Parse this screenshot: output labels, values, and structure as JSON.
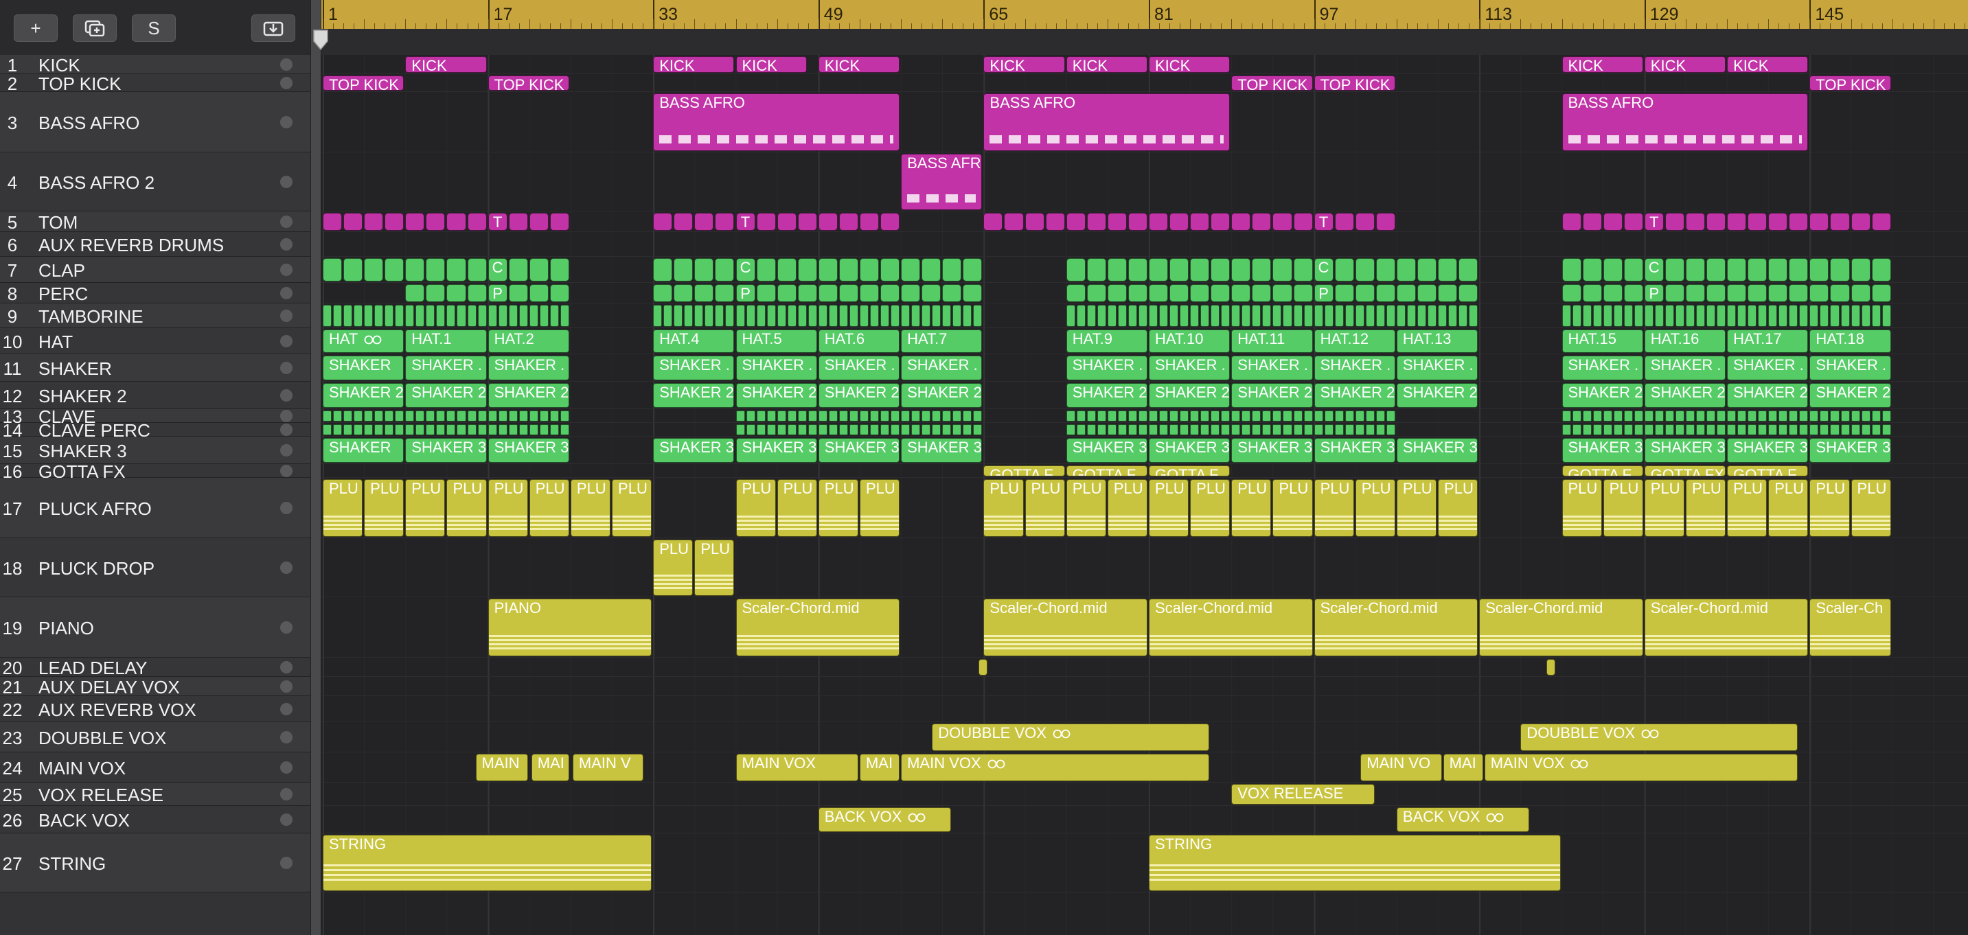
{
  "toolbar": {
    "add_track_icon": "+",
    "duplicate_track_icon": "duplicate-icon",
    "solo_label": "S",
    "download_icon": "download-icon"
  },
  "ruler": {
    "bars": [
      "1",
      "17",
      "33",
      "49",
      "65",
      "81",
      "97",
      "113",
      "129",
      "145"
    ]
  },
  "tracks": [
    {
      "num": "1",
      "name": "KICK"
    },
    {
      "num": "2",
      "name": "TOP KICK"
    },
    {
      "num": "3",
      "name": "BASS AFRO"
    },
    {
      "num": "4",
      "name": "BASS AFRO 2"
    },
    {
      "num": "5",
      "name": "TOM"
    },
    {
      "num": "6",
      "name": "AUX REVERB DRUMS"
    },
    {
      "num": "7",
      "name": "CLAP"
    },
    {
      "num": "8",
      "name": "PERC"
    },
    {
      "num": "9",
      "name": "TAMBORINE"
    },
    {
      "num": "10",
      "name": "HAT"
    },
    {
      "num": "11",
      "name": "SHAKER"
    },
    {
      "num": "12",
      "name": "SHAKER 2"
    },
    {
      "num": "13",
      "name": "CLAVE"
    },
    {
      "num": "14",
      "name": "CLAVE PERC"
    },
    {
      "num": "15",
      "name": "SHAKER 3"
    },
    {
      "num": "16",
      "name": "GOTTA FX"
    },
    {
      "num": "17",
      "name": "PLUCK AFRO"
    },
    {
      "num": "18",
      "name": "PLUCK DROP"
    },
    {
      "num": "19",
      "name": "PIANO"
    },
    {
      "num": "20",
      "name": "LEAD DELAY"
    },
    {
      "num": "21",
      "name": "AUX DELAY VOX"
    },
    {
      "num": "22",
      "name": "AUX REVERB VOX"
    },
    {
      "num": "23",
      "name": "DOUBBLE VOX"
    },
    {
      "num": "24",
      "name": "MAIN VOX"
    },
    {
      "num": "25",
      "name": "VOX RELEASE"
    },
    {
      "num": "26",
      "name": "BACK VOX"
    },
    {
      "num": "27",
      "name": "STRING"
    }
  ],
  "regions": [
    {
      "track": 0,
      "label": "KICK",
      "start": 9,
      "len": 8,
      "color": "pink"
    },
    {
      "track": 0,
      "label": "KICK",
      "start": 33,
      "len": 8,
      "color": "pink"
    },
    {
      "track": 0,
      "label": "KICK",
      "start": 41,
      "len": 7,
      "color": "pink"
    },
    {
      "track": 0,
      "label": "KICK",
      "start": 49,
      "len": 8,
      "color": "pink"
    },
    {
      "track": 0,
      "label": "KICK",
      "start": 65,
      "len": 8,
      "color": "pink"
    },
    {
      "track": 0,
      "label": "KICK",
      "start": 73,
      "len": 8,
      "color": "pink"
    },
    {
      "track": 0,
      "label": "KICK",
      "start": 81,
      "len": 8,
      "color": "pink"
    },
    {
      "track": 0,
      "label": "KICK",
      "start": 121,
      "len": 8,
      "color": "pink"
    },
    {
      "track": 0,
      "label": "KICK",
      "start": 129,
      "len": 8,
      "color": "pink"
    },
    {
      "track": 0,
      "label": "KICK",
      "start": 137,
      "len": 8,
      "color": "pink"
    },
    {
      "track": 1,
      "label": "TOP KICK",
      "start": 1,
      "len": 8,
      "color": "pink"
    },
    {
      "track": 1,
      "label": "TOP KICK",
      "start": 17,
      "len": 8,
      "color": "pink"
    },
    {
      "track": 1,
      "label": "TOP KICK",
      "start": 89,
      "len": 8,
      "color": "pink"
    },
    {
      "track": 1,
      "label": "TOP KICK",
      "start": 97,
      "len": 8,
      "color": "pink"
    },
    {
      "track": 1,
      "label": "TOP KICK",
      "start": 145,
      "len": 8,
      "color": "pink"
    },
    {
      "track": 2,
      "label": "BASS AFRO",
      "start": 33,
      "len": 24,
      "color": "pink",
      "tall": true
    },
    {
      "track": 2,
      "label": "BASS AFRO",
      "start": 65,
      "len": 24,
      "color": "pink",
      "tall": true
    },
    {
      "track": 2,
      "label": "BASS AFRO",
      "start": 121,
      "len": 24,
      "color": "pink",
      "tall": true
    },
    {
      "track": 3,
      "label": "BASS AFRO",
      "start": 57,
      "len": 8,
      "color": "pink",
      "tall": true
    },
    {
      "track": 4,
      "label": "T",
      "start": 17,
      "len": 8,
      "color": "pink",
      "pattern": "T"
    },
    {
      "track": 4,
      "label": "T",
      "start": 41,
      "len": 8,
      "color": "pink",
      "pattern": "T"
    },
    {
      "track": 4,
      "label": "T",
      "start": 81,
      "len": 24,
      "color": "pink",
      "pattern": "T"
    },
    {
      "track": 6,
      "label": "C",
      "start": 1,
      "len": 24,
      "color": "green",
      "pattern": "C"
    },
    {
      "track": 6,
      "label": "C",
      "start": 33,
      "len": 32,
      "color": "green",
      "pattern": "C"
    },
    {
      "track": 6,
      "label": "C",
      "start": 73,
      "len": 40,
      "color": "green",
      "pattern": "C"
    },
    {
      "track": 6,
      "label": "C",
      "start": 121,
      "len": 32,
      "color": "green",
      "pattern": "C"
    },
    {
      "track": 7,
      "label": "P",
      "start": 9,
      "len": 16,
      "color": "green",
      "pattern": "P"
    },
    {
      "track": 7,
      "label": "P",
      "start": 33,
      "len": 32,
      "color": "green",
      "pattern": "P"
    },
    {
      "track": 7,
      "label": "P",
      "start": 73,
      "len": 40,
      "color": "green",
      "pattern": "P"
    },
    {
      "track": 7,
      "label": "P",
      "start": 121,
      "len": 32,
      "color": "green",
      "pattern": "P"
    },
    {
      "track": 9,
      "label": "HAT",
      "start": 1,
      "len": 8,
      "color": "green",
      "loop": true
    },
    {
      "track": 9,
      "label": "HAT.1",
      "start": 9,
      "len": 8,
      "color": "green"
    },
    {
      "track": 9,
      "label": "HAT.2",
      "start": 17,
      "len": 8,
      "color": "green"
    },
    {
      "track": 9,
      "label": "HAT.4",
      "start": 33,
      "len": 8,
      "color": "green"
    },
    {
      "track": 9,
      "label": "HAT.5",
      "start": 41,
      "len": 8,
      "color": "green"
    },
    {
      "track": 9,
      "label": "HAT.6",
      "start": 49,
      "len": 8,
      "color": "green"
    },
    {
      "track": 9,
      "label": "HAT.7",
      "start": 57,
      "len": 8,
      "color": "green"
    },
    {
      "track": 9,
      "label": "HAT.9",
      "start": 73,
      "len": 8,
      "color": "green"
    },
    {
      "track": 9,
      "label": "HAT.10",
      "start": 81,
      "len": 8,
      "color": "green"
    },
    {
      "track": 9,
      "label": "HAT.11",
      "start": 89,
      "len": 8,
      "color": "green"
    },
    {
      "track": 9,
      "label": "HAT.12",
      "start": 97,
      "len": 8,
      "color": "green"
    },
    {
      "track": 9,
      "label": "HAT.13",
      "start": 105,
      "len": 8,
      "color": "green"
    },
    {
      "track": 9,
      "label": "HAT.15",
      "start": 121,
      "len": 8,
      "color": "green"
    },
    {
      "track": 9,
      "label": "HAT.16",
      "start": 129,
      "len": 8,
      "color": "green"
    },
    {
      "track": 9,
      "label": "HAT.17",
      "start": 137,
      "len": 8,
      "color": "green"
    },
    {
      "track": 9,
      "label": "HAT.18",
      "start": 145,
      "len": 8,
      "color": "green"
    },
    {
      "track": 10,
      "label": "SHAKER",
      "start": 1,
      "len": 8,
      "color": "green"
    },
    {
      "track": 10,
      "label": "SHAKER .",
      "start": 9,
      "len": 8,
      "color": "green"
    },
    {
      "track": 10,
      "label": "SHAKER .",
      "start": 17,
      "len": 8,
      "color": "green"
    },
    {
      "track": 10,
      "label": "SHAKER .",
      "start": 33,
      "len": 8,
      "color": "green"
    },
    {
      "track": 10,
      "label": "SHAKER .",
      "start": 41,
      "len": 8,
      "color": "green"
    },
    {
      "track": 10,
      "label": "SHAKER .",
      "start": 49,
      "len": 8,
      "color": "green"
    },
    {
      "track": 10,
      "label": "SHAKER .",
      "start": 57,
      "len": 8,
      "color": "green"
    },
    {
      "track": 10,
      "label": "SHAKER .",
      "start": 73,
      "len": 8,
      "color": "green"
    },
    {
      "track": 10,
      "label": "SHAKER .",
      "start": 81,
      "len": 8,
      "color": "green"
    },
    {
      "track": 10,
      "label": "SHAKER .",
      "start": 89,
      "len": 8,
      "color": "green"
    },
    {
      "track": 10,
      "label": "SHAKER .",
      "start": 97,
      "len": 8,
      "color": "green"
    },
    {
      "track": 10,
      "label": "SHAKER .",
      "start": 105,
      "len": 8,
      "color": "green"
    },
    {
      "track": 10,
      "label": "SHAKER .",
      "start": 121,
      "len": 8,
      "color": "green"
    },
    {
      "track": 10,
      "label": "SHAKER .",
      "start": 129,
      "len": 8,
      "color": "green"
    },
    {
      "track": 10,
      "label": "SHAKER .",
      "start": 137,
      "len": 8,
      "color": "green"
    },
    {
      "track": 10,
      "label": "SHAKER .",
      "start": 145,
      "len": 8,
      "color": "green"
    },
    {
      "track": 11,
      "label": "SHAKER 2",
      "start": 1,
      "len": 8,
      "color": "green"
    },
    {
      "track": 11,
      "label": "SHAKER 2",
      "start": 9,
      "len": 8,
      "color": "green"
    },
    {
      "track": 11,
      "label": "SHAKER 2",
      "start": 17,
      "len": 8,
      "color": "green"
    },
    {
      "track": 11,
      "label": "SHAKER 2",
      "start": 33,
      "len": 8,
      "color": "green"
    },
    {
      "track": 11,
      "label": "SHAKER 2",
      "start": 41,
      "len": 8,
      "color": "green"
    },
    {
      "track": 11,
      "label": "SHAKER 2",
      "start": 49,
      "len": 8,
      "color": "green"
    },
    {
      "track": 11,
      "label": "SHAKER 2",
      "start": 57,
      "len": 8,
      "color": "green"
    },
    {
      "track": 11,
      "label": "SHAKER 2",
      "start": 73,
      "len": 8,
      "color": "green"
    },
    {
      "track": 11,
      "label": "SHAKER 2",
      "start": 81,
      "len": 8,
      "color": "green"
    },
    {
      "track": 11,
      "label": "SHAKER 2",
      "start": 89,
      "len": 8,
      "color": "green"
    },
    {
      "track": 11,
      "label": "SHAKER 2",
      "start": 97,
      "len": 8,
      "color": "green"
    },
    {
      "track": 11,
      "label": "SHAKER 2",
      "start": 105,
      "len": 8,
      "color": "green"
    },
    {
      "track": 11,
      "label": "SHAKER 2",
      "start": 121,
      "len": 8,
      "color": "green"
    },
    {
      "track": 11,
      "label": "SHAKER 2",
      "start": 129,
      "len": 8,
      "color": "green"
    },
    {
      "track": 11,
      "label": "SHAKER 2",
      "start": 137,
      "len": 8,
      "color": "green"
    },
    {
      "track": 11,
      "label": "SHAKER 2",
      "start": 145,
      "len": 8,
      "color": "green"
    },
    {
      "track": 14,
      "label": "SHAKER",
      "start": 1,
      "len": 8,
      "color": "green"
    },
    {
      "track": 14,
      "label": "SHAKER 3",
      "start": 9,
      "len": 8,
      "color": "green"
    },
    {
      "track": 14,
      "label": "SHAKER 3",
      "start": 17,
      "len": 8,
      "color": "green"
    },
    {
      "track": 14,
      "label": "SHAKER 3",
      "start": 33,
      "len": 8,
      "color": "green"
    },
    {
      "track": 14,
      "label": "SHAKER 3",
      "start": 41,
      "len": 8,
      "color": "green"
    },
    {
      "track": 14,
      "label": "SHAKER 3",
      "start": 49,
      "len": 8,
      "color": "green"
    },
    {
      "track": 14,
      "label": "SHAKER 3",
      "start": 57,
      "len": 8,
      "color": "green"
    },
    {
      "track": 14,
      "label": "SHAKER 3",
      "start": 73,
      "len": 8,
      "color": "green"
    },
    {
      "track": 14,
      "label": "SHAKER 3",
      "start": 81,
      "len": 8,
      "color": "green"
    },
    {
      "track": 14,
      "label": "SHAKER 3",
      "start": 89,
      "len": 8,
      "color": "green"
    },
    {
      "track": 14,
      "label": "SHAKER 3",
      "start": 97,
      "len": 8,
      "color": "green"
    },
    {
      "track": 14,
      "label": "SHAKER 3",
      "start": 105,
      "len": 8,
      "color": "green"
    },
    {
      "track": 14,
      "label": "SHAKER 3",
      "start": 121,
      "len": 8,
      "color": "green"
    },
    {
      "track": 14,
      "label": "SHAKER 3",
      "start": 129,
      "len": 8,
      "color": "green"
    },
    {
      "track": 14,
      "label": "SHAKER 3",
      "start": 137,
      "len": 8,
      "color": "green"
    },
    {
      "track": 14,
      "label": "SHAKER 3",
      "start": 145,
      "len": 8,
      "color": "green"
    },
    {
      "track": 15,
      "label": "GOTTA F",
      "start": 65,
      "len": 8,
      "color": "yellow"
    },
    {
      "track": 15,
      "label": "GOTTA F",
      "start": 73,
      "len": 8,
      "color": "yellow"
    },
    {
      "track": 15,
      "label": "GOTTA F",
      "start": 81,
      "len": 8,
      "color": "yellow"
    },
    {
      "track": 15,
      "label": "GOTTA F",
      "start": 121,
      "len": 8,
      "color": "yellow"
    },
    {
      "track": 15,
      "label": "GOTTA FX",
      "start": 129,
      "len": 8,
      "color": "yellow"
    },
    {
      "track": 15,
      "label": "GOTTA F",
      "start": 137,
      "len": 8,
      "color": "yellow"
    },
    {
      "track": 17,
      "label": "PLU",
      "start": 33,
      "len": 4,
      "color": "yellow",
      "tall": true
    },
    {
      "track": 17,
      "label": "PLU",
      "start": 37,
      "len": 4,
      "color": "yellow",
      "tall": true
    },
    {
      "track": 18,
      "label": "PIANO",
      "start": 17,
      "len": 16,
      "color": "yellow",
      "tall": true
    },
    {
      "track": 18,
      "label": "Scaler-Chord.mid",
      "start": 41,
      "len": 16,
      "color": "yellow",
      "tall": true
    },
    {
      "track": 18,
      "label": "Scaler-Chord.mid",
      "start": 65,
      "len": 16,
      "color": "yellow",
      "tall": true
    },
    {
      "track": 18,
      "label": "Scaler-Chord.mid",
      "start": 81,
      "len": 16,
      "color": "yellow",
      "tall": true
    },
    {
      "track": 18,
      "label": "Scaler-Chord.mid",
      "start": 97,
      "len": 16,
      "color": "yellow",
      "tall": true
    },
    {
      "track": 18,
      "label": "Scaler-Chord.mid",
      "start": 113,
      "len": 16,
      "color": "yellow",
      "tall": true
    },
    {
      "track": 18,
      "label": "Scaler-Chord.mid",
      "start": 129,
      "len": 16,
      "color": "yellow",
      "tall": true
    },
    {
      "track": 18,
      "label": "Scaler-Ch",
      "start": 145,
      "len": 8,
      "color": "yellow",
      "tall": true
    },
    {
      "track": 19,
      "label": "",
      "start": 64.5,
      "len": 1,
      "color": "yellow"
    },
    {
      "track": 19,
      "label": "",
      "start": 119.5,
      "len": 1,
      "color": "yellow"
    },
    {
      "track": 22,
      "label": "DOUBBLE VOX",
      "start": 60,
      "len": 27,
      "color": "yellow",
      "loop": true
    },
    {
      "track": 22,
      "label": "DOUBBLE VOX",
      "start": 117,
      "len": 27,
      "color": "yellow",
      "loop": true
    },
    {
      "track": 23,
      "label": "MAIN",
      "start": 15.8,
      "len": 5.2,
      "color": "yellow"
    },
    {
      "track": 23,
      "label": "MAI",
      "start": 21.2,
      "len": 3.8,
      "color": "yellow"
    },
    {
      "track": 23,
      "label": "MAIN V",
      "start": 25.2,
      "len": 7,
      "color": "yellow"
    },
    {
      "track": 23,
      "label": "MAIN VOX",
      "start": 41,
      "len": 12,
      "color": "yellow"
    },
    {
      "track": 23,
      "label": "MAI",
      "start": 53,
      "len": 4,
      "color": "yellow"
    },
    {
      "track": 23,
      "label": "MAIN VOX",
      "start": 57,
      "len": 30,
      "color": "yellow",
      "loop": true
    },
    {
      "track": 23,
      "label": "MAIN VO",
      "start": 101.5,
      "len": 8,
      "color": "yellow"
    },
    {
      "track": 23,
      "label": "MAI",
      "start": 109.5,
      "len": 4,
      "color": "yellow"
    },
    {
      "track": 23,
      "label": "MAIN VOX",
      "start": 113.5,
      "len": 30.5,
      "color": "yellow",
      "loop": true
    },
    {
      "track": 24,
      "label": "VOX RELEASE",
      "start": 89,
      "len": 14,
      "color": "yellow"
    },
    {
      "track": 25,
      "label": "BACK VOX",
      "start": 49,
      "len": 13,
      "color": "yellow",
      "loop": true
    },
    {
      "track": 25,
      "label": "BACK VOX",
      "start": 105,
      "len": 13,
      "color": "yellow",
      "loop": true
    },
    {
      "track": 26,
      "label": "STRING",
      "start": 1,
      "len": 32,
      "color": "yellow",
      "string": true
    },
    {
      "track": 26,
      "label": "STRING",
      "start": 81,
      "len": 40,
      "color": "yellow",
      "string": true
    }
  ],
  "pluck_afro": {
    "label": "PLU",
    "ranges": [
      [
        1,
        33
      ],
      [
        41,
        57
      ],
      [
        65,
        113
      ],
      [
        121,
        153
      ]
    ]
  },
  "tamborine_ranges": [
    [
      1,
      25
    ],
    [
      33,
      65
    ],
    [
      73,
      113
    ],
    [
      121,
      153
    ]
  ],
  "clave_ranges": [
    [
      1,
      25
    ],
    [
      41,
      65
    ],
    [
      73,
      105
    ],
    [
      121,
      153
    ]
  ],
  "tom_ranges": [
    [
      1,
      25
    ],
    [
      33,
      57
    ],
    [
      65,
      105
    ],
    [
      121,
      153
    ]
  ],
  "colors": {
    "pink": "#c133a6",
    "green": "#56cc67",
    "yellow": "#c9c43f",
    "ruler": "#c9a53e"
  }
}
